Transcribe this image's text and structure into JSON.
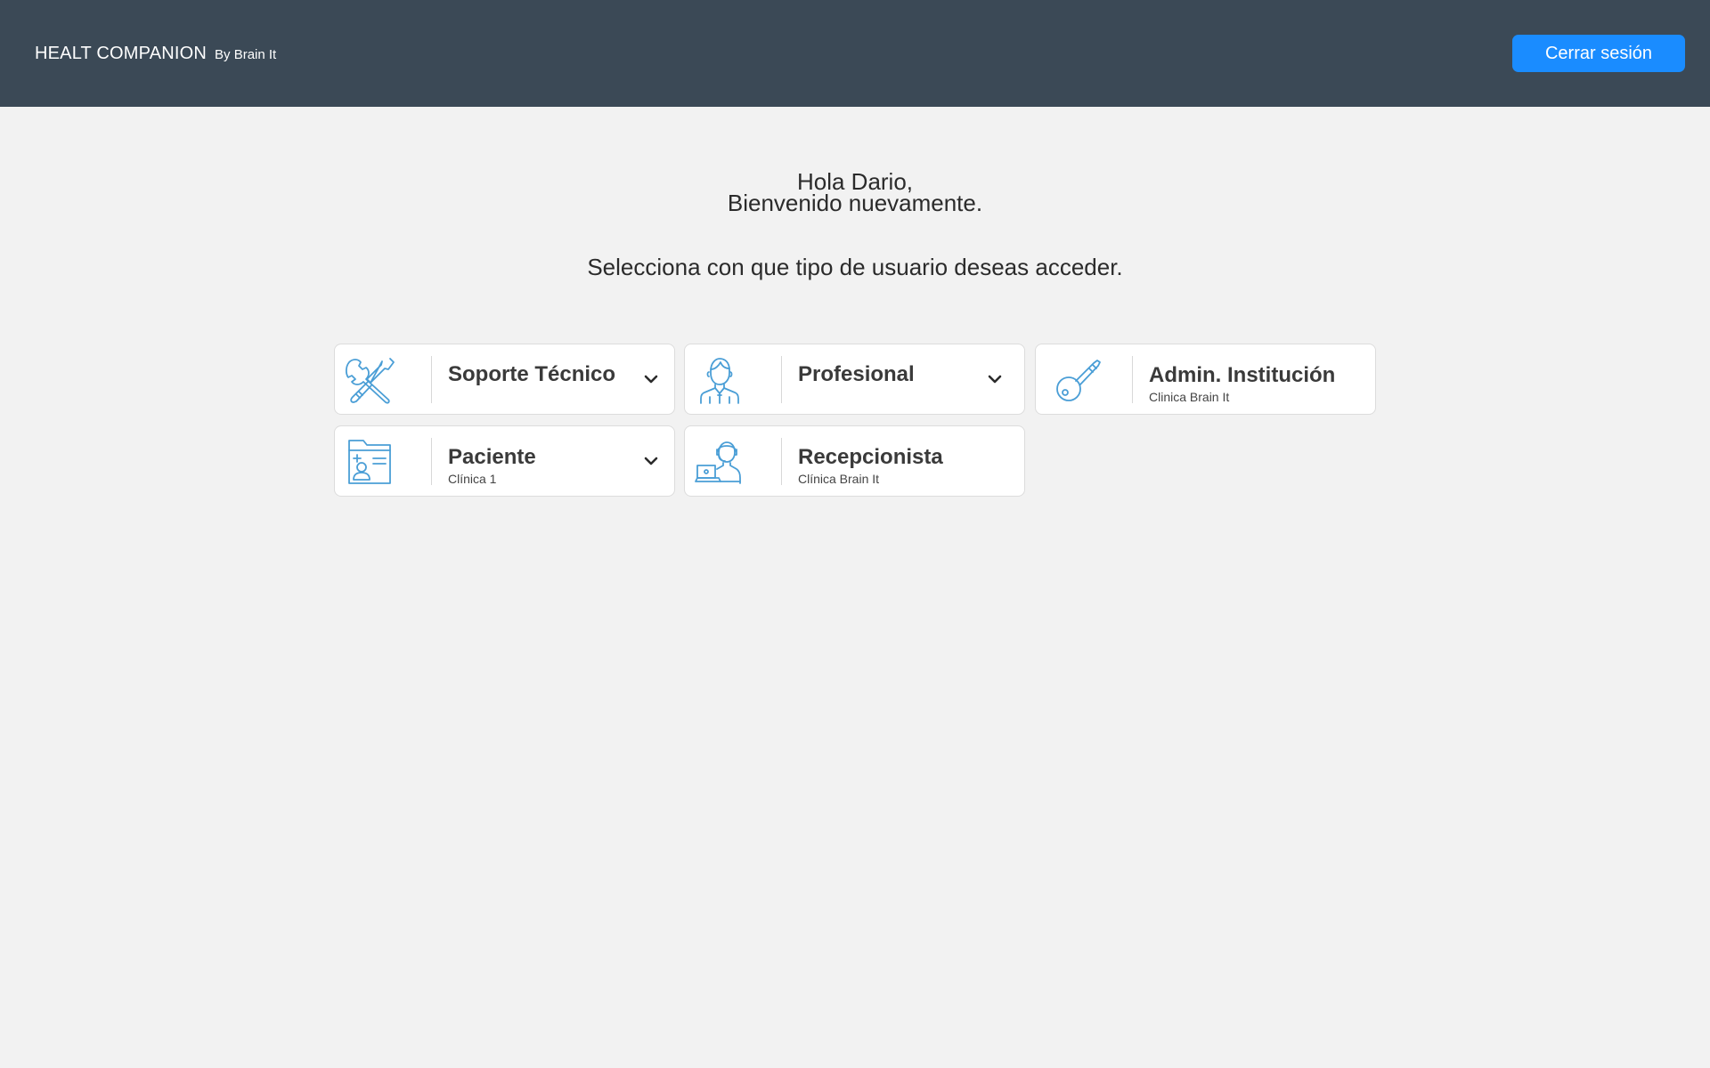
{
  "header": {
    "brand_name": "HEALT COMPANION",
    "brand_by": "By Brain It",
    "logout_label": "Cerrar sesión",
    "background_color": "#3b4956",
    "button_color": "#1a8cff"
  },
  "welcome": {
    "line1": "Hola Dario,",
    "line2": "Bienvenido nuevamente.",
    "prompt": "Selecciona con que tipo de usuario deseas acceder."
  },
  "accent_color": "#4a9ed6",
  "roles": [
    {
      "title": "Soporte Técnico",
      "subtitle": "",
      "icon": "tools-icon",
      "dropdown": true
    },
    {
      "title": "Profesional",
      "subtitle": "",
      "icon": "professional-icon",
      "dropdown": true
    },
    {
      "title": "Admin. Institución",
      "subtitle": "Clinica Brain It",
      "icon": "key-icon",
      "dropdown": false
    },
    {
      "title": "Paciente",
      "subtitle": "Clínica 1",
      "icon": "patient-file-icon",
      "dropdown": true
    },
    {
      "title": "Recepcionista",
      "subtitle": "Clínica Brain It",
      "icon": "receptionist-icon",
      "dropdown": false
    }
  ]
}
